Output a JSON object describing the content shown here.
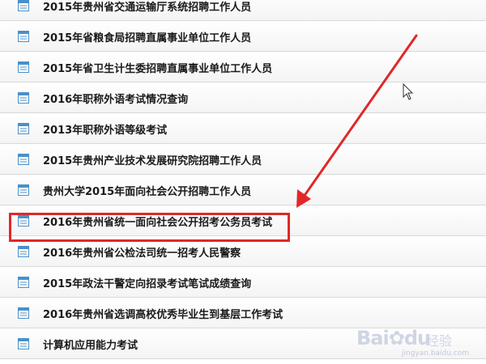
{
  "items": [
    {
      "label": "2015年贵州省交通运输厅系统招聘工作人员"
    },
    {
      "label": "2015年省粮食局招聘直属事业单位工作人员"
    },
    {
      "label": "2015年省卫生计生委招聘直属事业单位工作人员"
    },
    {
      "label": "2016年职称外语考试情况查询"
    },
    {
      "label": "2013年职称外语等级考试"
    },
    {
      "label": "2015年贵州产业技术发展研究院招聘工作人员"
    },
    {
      "label": "贵州大学2015年面向社会公开招聘工作人员"
    },
    {
      "label": "2016年贵州省统一面向社会公开招考公务员考试"
    },
    {
      "label": "2016年贵州省公检法司统一招考人民警察"
    },
    {
      "label": "2015年政法干警定向招录考试笔试成绩查询"
    },
    {
      "label": "2016年贵州省选调高校优秀毕业生到基层工作考试"
    },
    {
      "label": "计算机应用能力考试"
    }
  ],
  "highlighted_index": 7,
  "item_icon": "list-icon",
  "annotation_color": "#e02828",
  "watermark": {
    "brand": "Bai",
    "brand_suffix": "du",
    "word": "经验",
    "url": "jingyan.baidu.com"
  }
}
